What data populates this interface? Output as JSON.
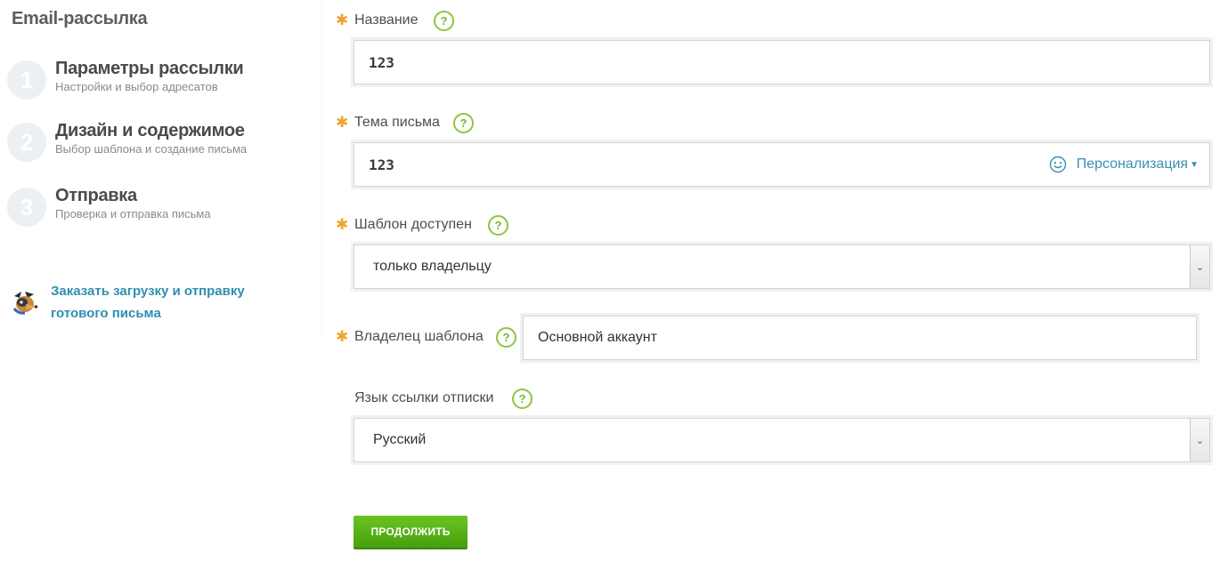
{
  "sidebar": {
    "title": "Email-рассылка",
    "steps": [
      {
        "number": "1",
        "title": "Параметры рассылки",
        "subtitle": "Настройки и выбор адресатов"
      },
      {
        "number": "2",
        "title": "Дизайн и содержимое",
        "subtitle": "Выбор шаблона и создание письма"
      },
      {
        "number": "3",
        "title": "Отправка",
        "subtitle": "Проверка и отправка письма"
      }
    ],
    "order_link": "Заказать загрузку и отправку готового письма",
    "order_icon": "mascot-icon"
  },
  "form": {
    "required_mark": "✱",
    "help_mark": "?",
    "name": {
      "label": "Название",
      "value": "123",
      "required": true
    },
    "subject": {
      "label": "Тема письма",
      "value": "123",
      "required": true,
      "personalize_label": "Персонализация",
      "personalize_icon": "smile-icon"
    },
    "template_access": {
      "label": "Шаблон доступен",
      "selected": "только владельцу",
      "required": true
    },
    "template_owner": {
      "label": "Владелец шаблона",
      "value": "Основной аккаунт",
      "required": true
    },
    "unsubscribe_lang": {
      "label": "Язык ссылки отписки",
      "selected": "Русский",
      "required": false
    },
    "continue_label": "ПРОДОЛЖИТЬ"
  },
  "colors": {
    "accent_green": "#8cc63f",
    "button_green": "#55b012",
    "link_blue": "#2f8fb0",
    "required_orange": "#f0a231"
  }
}
